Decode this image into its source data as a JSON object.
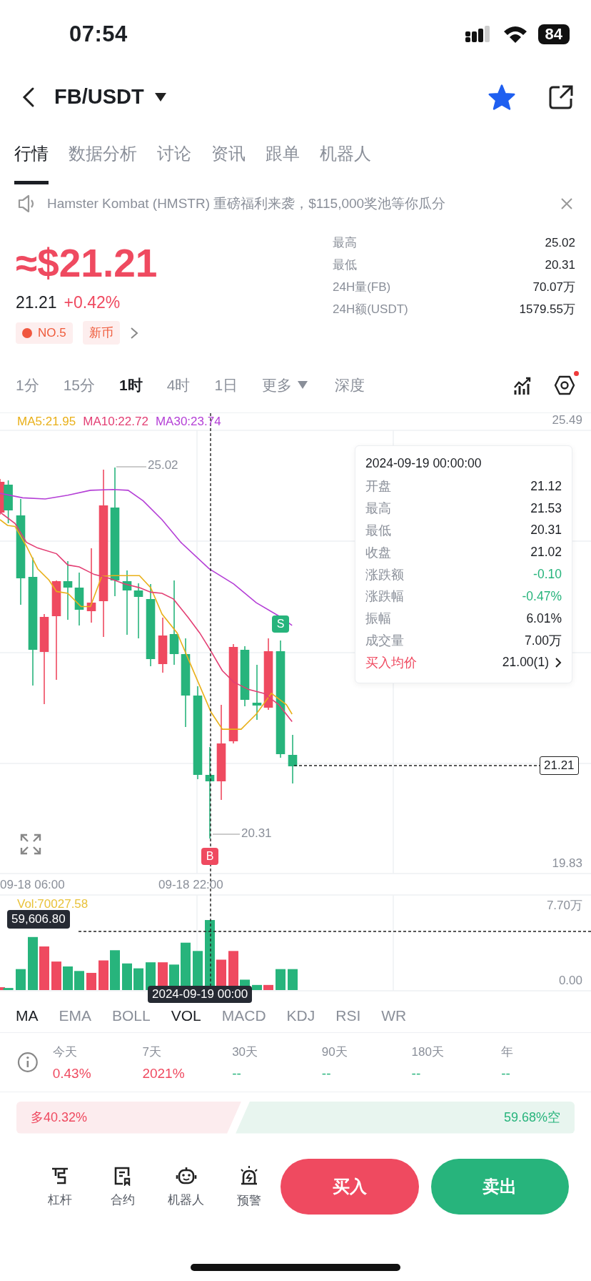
{
  "status_bar": {
    "time": "07:54",
    "battery": "84"
  },
  "header": {
    "pair": "FB/USDT",
    "favorite": true
  },
  "tabs": [
    {
      "label": "行情",
      "selected": true
    },
    {
      "label": "数据分析",
      "selected": false
    },
    {
      "label": "讨论",
      "selected": false
    },
    {
      "label": "资讯",
      "selected": false
    },
    {
      "label": "跟单",
      "selected": false
    },
    {
      "label": "机器人",
      "selected": false
    }
  ],
  "announcement": {
    "text": "Hamster Kombat (HMSTR) 重磅福利来袭，$115,000奖池等你瓜分"
  },
  "price": {
    "approx": "≈$21.21",
    "last": "21.21",
    "change": "+0.42%"
  },
  "badges": [
    {
      "label": "NO.5",
      "kind": "rank"
    },
    {
      "label": "新币",
      "kind": "tag"
    }
  ],
  "stats": [
    {
      "label": "最高",
      "value": "25.02"
    },
    {
      "label": "最低",
      "value": "20.31"
    },
    {
      "label": "24H量(FB)",
      "value": "70.07万"
    },
    {
      "label": "24H额(USDT)",
      "value": "1579.55万"
    }
  ],
  "intervals": [
    {
      "label": "1分",
      "selected": false
    },
    {
      "label": "15分",
      "selected": false
    },
    {
      "label": "1时",
      "selected": true
    },
    {
      "label": "4时",
      "selected": false
    },
    {
      "label": "1日",
      "selected": false
    }
  ],
  "more_label": "更多",
  "depth_label": "深度",
  "settings_notice": true,
  "chart": {
    "ma_legend": [
      {
        "label": "MA5:21.95",
        "color": "#e9b019"
      },
      {
        "label": "MA10:22.72",
        "color": "#e33f74"
      },
      {
        "label": "MA30:23.74",
        "color": "#b43fd6"
      }
    ],
    "top_tick": "25.49",
    "bottom_tick": "19.83",
    "high_mark": "25.02",
    "low_mark": "20.31",
    "time_labels": [
      "09-18 06:00",
      "09-18 22:00"
    ],
    "last_price_tag": "21.21",
    "sell_marker": "S",
    "buy_marker": "B",
    "tooltip": {
      "title": "2024-09-19 00:00:00",
      "rows": [
        {
          "label": "开盘",
          "value": "21.12",
          "kind": "plain"
        },
        {
          "label": "最高",
          "value": "21.53",
          "kind": "plain"
        },
        {
          "label": "最低",
          "value": "20.31",
          "kind": "plain"
        },
        {
          "label": "收盘",
          "value": "21.02",
          "kind": "plain"
        },
        {
          "label": "涨跌额",
          "value": "-0.10",
          "kind": "down"
        },
        {
          "label": "涨跌幅",
          "value": "-0.47%",
          "kind": "down"
        },
        {
          "label": "振幅",
          "value": "6.01%",
          "kind": "plain"
        },
        {
          "label": "成交量",
          "value": "7.00万",
          "kind": "plain"
        },
        {
          "label": "买入均价",
          "value": "21.00(1)",
          "kind": "link"
        }
      ]
    }
  },
  "volume": {
    "legend": "Vol:70027.58",
    "max_tick": "7.70万",
    "min_tick": "0.00",
    "cursor_value": "59,606.80",
    "cursor_time": "2024-09-19 00:00"
  },
  "indicators": [
    {
      "label": "MA",
      "selected": true
    },
    {
      "label": "EMA",
      "selected": false
    },
    {
      "label": "BOLL",
      "selected": false
    },
    {
      "label": "VOL",
      "selected": true
    },
    {
      "label": "MACD",
      "selected": false
    },
    {
      "label": "KDJ",
      "selected": false
    },
    {
      "label": "RSI",
      "selected": false
    },
    {
      "label": "WR",
      "selected": false
    }
  ],
  "returns": [
    {
      "period": "今天",
      "value": "0.43%",
      "color": "#ef4a60"
    },
    {
      "period": "7天",
      "value": "2021%",
      "color": "#ef4a60"
    },
    {
      "period": "30天",
      "value": "--",
      "color": "#27b47c"
    },
    {
      "period": "90天",
      "value": "--",
      "color": "#27b47c"
    },
    {
      "period": "180天",
      "value": "--",
      "color": "#27b47c"
    },
    {
      "period": "年",
      "value": "--",
      "color": "#27b47c"
    }
  ],
  "long_short": {
    "long": "多40.32%",
    "short": "59.68%空"
  },
  "actions": [
    {
      "label": "杠杆",
      "kind": "leverage"
    },
    {
      "label": "合约",
      "kind": "contract"
    },
    {
      "label": "机器人",
      "kind": "robot"
    },
    {
      "label": "预警",
      "kind": "alert"
    }
  ],
  "buy": "买入",
  "sell": "卖出"
}
